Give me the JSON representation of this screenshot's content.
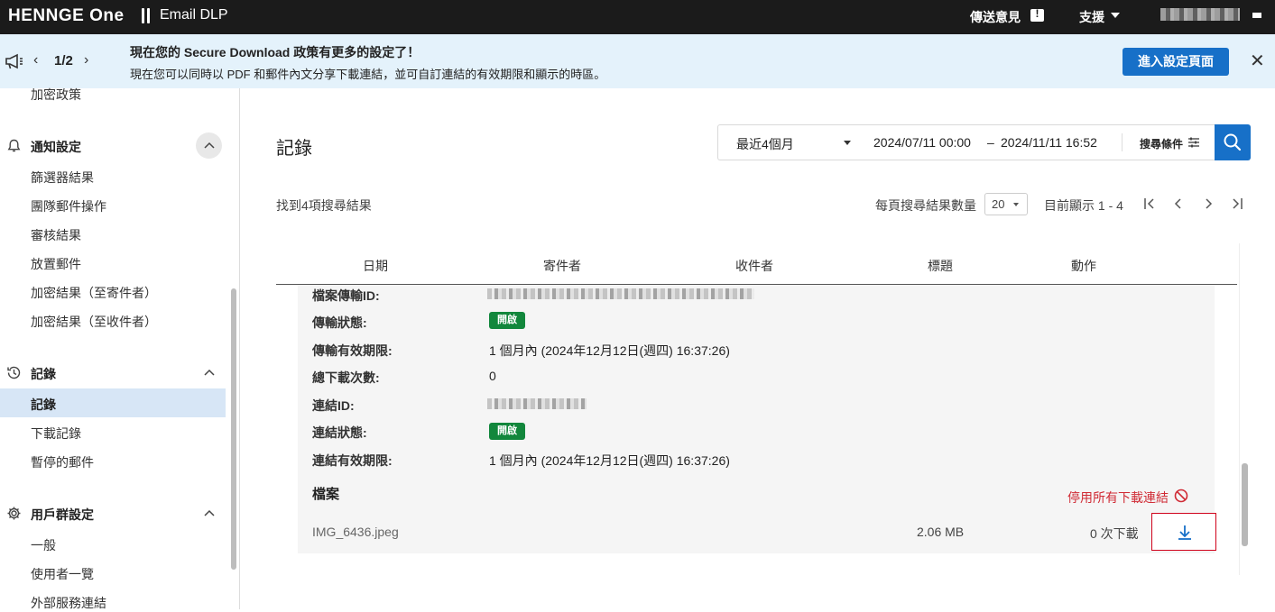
{
  "topbar": {
    "logo": "HENNGE One",
    "app_name": "Email DLP",
    "feedback": "傳送意見",
    "support": "支援"
  },
  "banner": {
    "pager": "1/2",
    "title": "現在您的 Secure Download 政策有更多的設定了！",
    "body": "現在您可以同時以 PDF 和郵件內文分享下載連結，並可自訂連結的有效期限和顯示的時區。",
    "button": "進入設定頁面"
  },
  "sidebar": {
    "top_item": "加密政策",
    "sections": [
      {
        "title": "通知設定",
        "icon": "bell-icon",
        "items": [
          "篩選器結果",
          "團隊郵件操作",
          "審核結果",
          "放置郵件",
          "加密結果（至寄件者）",
          "加密結果（至收件者）"
        ]
      },
      {
        "title": "記錄",
        "icon": "history-icon",
        "items": [
          "記錄",
          "下載記錄",
          "暫停的郵件"
        ],
        "active_index": 0
      },
      {
        "title": "用戶群設定",
        "icon": "gear-icon",
        "items": [
          "一般",
          "使用者一覽",
          "外部服務連結"
        ]
      }
    ]
  },
  "main": {
    "title": "記錄",
    "filter": {
      "range": "最近4個月",
      "from": "2024/07/11  00:00",
      "separator": "–",
      "to": "2024/11/11  16:52",
      "conditions": "搜尋條件"
    },
    "result_count": "找到4項搜尋結果",
    "per_page_label": "每頁搜尋結果數量",
    "per_page": "20",
    "showing": "目前顯示 1 - 4",
    "columns": [
      "日期",
      "寄件者",
      "收件者",
      "標題",
      "動作"
    ],
    "details": [
      {
        "label": "檔案傳輸ID:",
        "value": null
      },
      {
        "label": "傳輸狀態:",
        "badge": "開啟"
      },
      {
        "label": "傳輸有效期限:",
        "value": "1 個月內 (2024年12月12日(週四) 16:37:26)"
      },
      {
        "label": "總下載次數:",
        "value": "0"
      },
      {
        "label": "連結ID:",
        "value": null
      },
      {
        "label": "連結狀態:",
        "badge": "開啟"
      },
      {
        "label": "連結有效期限:",
        "value": "1 個月內 (2024年12月12日(週四) 16:37:26)"
      }
    ],
    "files_title": "檔案",
    "disable_all": "停用所有下載連結",
    "file": {
      "name": "IMG_6436.jpeg",
      "size": "2.06 MB",
      "downloads": "0 次下載"
    }
  },
  "colors": {
    "primary": "#1770c8",
    "badge_green": "#12873c",
    "danger": "#d02b35",
    "banner_bg": "#e4f2fb",
    "active_nav": "#d7e6f6"
  }
}
